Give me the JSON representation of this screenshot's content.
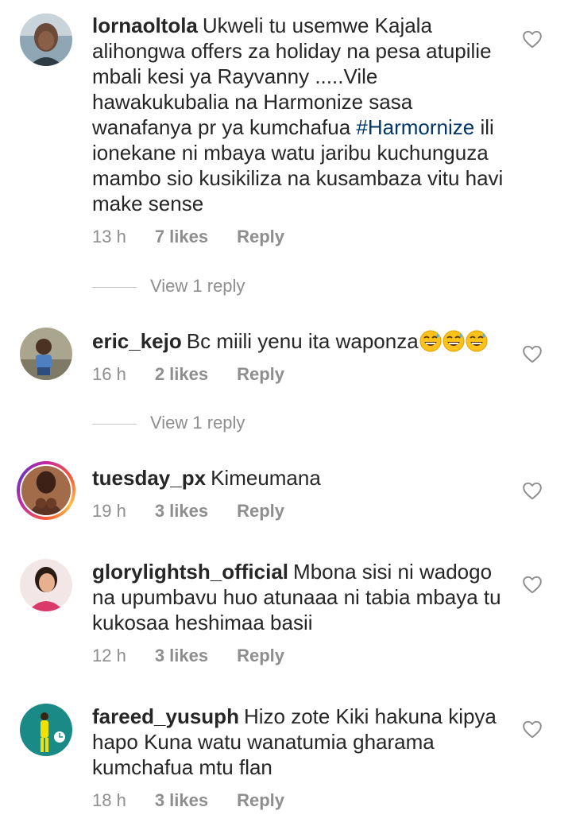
{
  "comments": [
    {
      "username": "lornaoltola",
      "text_before": "Ukweli tu usemwe Kajala alihongwa offers za holiday na pesa atupilie mbali kesi ya Rayvanny .....Vile hawakukubalia na Harmonize sasa wanafanya pr ya kumchafua ",
      "hashtag": "#Harmornize",
      "text_after": " ili ionekane ni mbaya watu jaribu kuchunguza mambo sio kusikiliza na kusambaza vitu havi make sense",
      "time": "13 h",
      "likes": "7 likes",
      "reply": "Reply",
      "view_replies": "View 1 reply"
    },
    {
      "username": "eric_kejo",
      "text": "Bc miili yenu ita waponza",
      "emojis": [
        "grinning-sweat-emoji",
        "grinning-sweat-emoji",
        "grinning-sweat-emoji"
      ],
      "time": "16 h",
      "likes": "2 likes",
      "reply": "Reply",
      "view_replies": "View 1 reply"
    },
    {
      "username": "tuesday_px",
      "text": "Kimeumana",
      "time": "19 h",
      "likes": "3 likes",
      "reply": "Reply"
    },
    {
      "username": "glorylightsh_official",
      "text": "Mbona sisi ni wadogo na upumbavu huo atunaaa ni tabia mbaya tu kukosaa heshimaa basii",
      "time": "12 h",
      "likes": "3 likes",
      "reply": "Reply"
    },
    {
      "username": "fareed_yusuph",
      "text": "Hizo zote Kiki hakuna kipya hapo Kuna watu wanatumia gharama kumchafua mtu flan",
      "time": "18 h",
      "likes": "3 likes",
      "reply": "Reply"
    }
  ],
  "icons": {
    "like": "heart-outline-icon"
  },
  "colors": {
    "text": "#262626",
    "meta": "#8e8e8e",
    "hashtag": "#003569",
    "divider": "#c7c7c7"
  }
}
